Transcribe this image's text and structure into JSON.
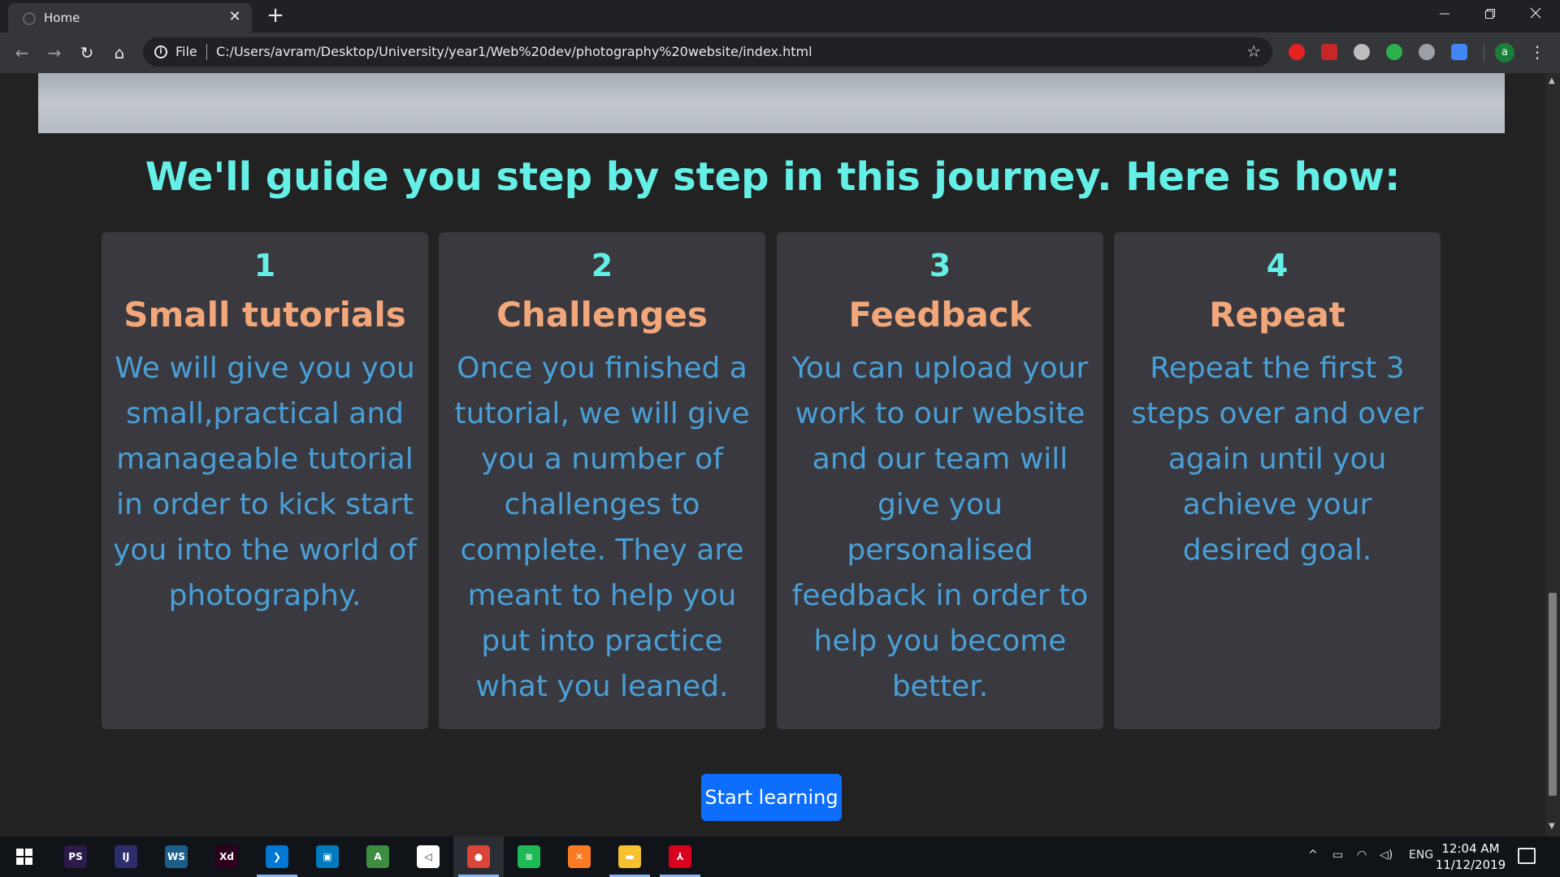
{
  "browser": {
    "tab_title": "Home",
    "tab_close": "✕",
    "new_tab": "+",
    "file_label": "File",
    "url": "C:/Users/avram/Desktop/University/year1/Web%20dev/photography%20website/index.html",
    "avatar_letter": "a"
  },
  "page": {
    "headline": "We'll guide you step by step in this journey. Here is how:",
    "steps": [
      {
        "number": "1",
        "title": "Small tutorials",
        "body": "We will give you you small,practical and manageable tutorial in order to kick start you into the world of photography."
      },
      {
        "number": "2",
        "title": "Challenges",
        "body": "Once you finished a tutorial, we will give you a number of challenges to complete. They are meant to help you put into practice what you leaned."
      },
      {
        "number": "3",
        "title": "Feedback",
        "body": "You can upload your work to our website and our team will give you personalised feedback in order to help you become better."
      },
      {
        "number": "4",
        "title": "Repeat",
        "body": "Repeat the first 3 steps over and over again until you achieve your desired goal."
      }
    ],
    "cta_label": "Start learning"
  },
  "taskbar": {
    "apps": [
      {
        "name": "photoshop",
        "label": "PS",
        "color": "#2b1a4a"
      },
      {
        "name": "intellij",
        "label": "IJ",
        "color": "#2d2d6e"
      },
      {
        "name": "webstorm",
        "label": "WS",
        "color": "#1b5e8a"
      },
      {
        "name": "adobe-xd",
        "label": "Xd",
        "color": "#2e001f"
      },
      {
        "name": "vscode",
        "label": "❯",
        "color": "#0078d4"
      },
      {
        "name": "trello",
        "label": "▣",
        "color": "#0079bf"
      },
      {
        "name": "android-studio",
        "label": "A",
        "color": "#3c8d40"
      },
      {
        "name": "unity",
        "label": "◁",
        "color": "#ffffff"
      },
      {
        "name": "chrome",
        "label": "●",
        "color": "#db4437"
      },
      {
        "name": "spotify",
        "label": "≋",
        "color": "#1db954"
      },
      {
        "name": "xampp",
        "label": "✕",
        "color": "#fb7a24"
      },
      {
        "name": "file-explorer",
        "label": "▬",
        "color": "#f5c12e"
      },
      {
        "name": "acrobat",
        "label": "⅄",
        "color": "#d9001e"
      }
    ],
    "language": "ENG",
    "time": "12:04 AM",
    "date": "11/12/2019"
  }
}
